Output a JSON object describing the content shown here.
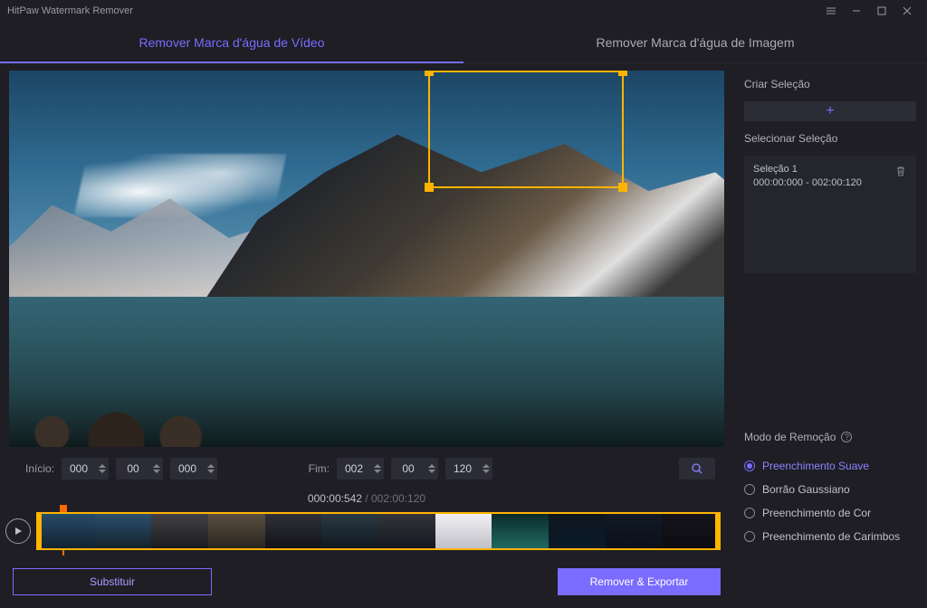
{
  "titlebar": {
    "app_name": "HitPaw Watermark Remover"
  },
  "tabs": {
    "video": "Remover Marca d'água de Vídeo",
    "image": "Remover Marca d'água de Imagem"
  },
  "timectrl": {
    "start_label": "Início:",
    "end_label": "Fim:",
    "start_h": "000",
    "start_m": "00",
    "start_s": "000",
    "end_h": "002",
    "end_m": "00",
    "end_s": "120"
  },
  "timecode": {
    "current": "000:00:542",
    "sep": " / ",
    "total": "002:00:120"
  },
  "right": {
    "create_label": "Criar Seleção",
    "select_label": "Selecionar Seleção",
    "selection": {
      "name": "Seleção 1",
      "range": "000:00:000 - 002:00:120"
    },
    "mode_label": "Modo de Remoção",
    "modes": {
      "m0": "Preenchimento Suave",
      "m1": "Borrão Gaussiano",
      "m2": "Preenchimento de Cor",
      "m3": "Preenchimento de Carimbos"
    }
  },
  "bottom": {
    "replace": "Substituir",
    "export": "Remover & Exportar"
  },
  "thumb_colors": [
    "linear-gradient(#264b6a,#132330)",
    "linear-gradient(#2a4f6e,#15232a)",
    "linear-gradient(#404046,#1b1b1f)",
    "linear-gradient(#5a4e40,#2a2620)",
    "linear-gradient(#303038,#121218)",
    "linear-gradient(#2a3a44,#101820)",
    "linear-gradient(#34343c,#161620)",
    "linear-gradient(#f0f0f4,#c0c0c8)",
    "linear-gradient(#0a2a2a,#206a60)",
    "linear-gradient(#10161e,#0a1a2a)",
    "linear-gradient(#121a26,#0a101a)",
    "linear-gradient(#14141a,#0c0c12)"
  ]
}
